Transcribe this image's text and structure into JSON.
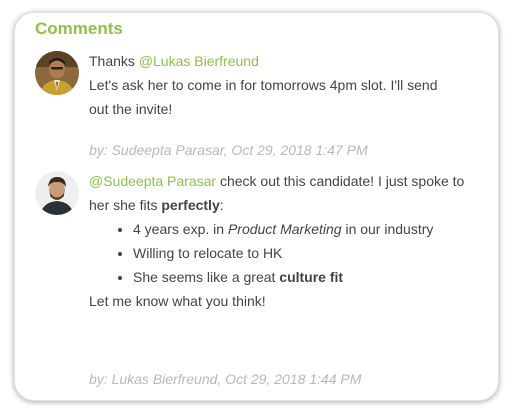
{
  "panel": {
    "title": "Comments"
  },
  "comments": [
    {
      "greeting": "Thanks",
      "mention": "@Lukas Bierfreund",
      "text": "Let's ask her to come in for tomorrows 4pm slot. I'll send out the invite!",
      "byline": "by: Sudeepta Parasar, Oct 29, 2018 1:47 PM"
    },
    {
      "mention": "@Sudeepta Parasar",
      "intro_text": "check out this candidate! I just spoke to her she fits",
      "intro_bold": "perfectly",
      "intro_end": ":",
      "bullets": [
        {
          "prefix": "4 years exp. in",
          "emphasis": "Product Marketing",
          "suffix": "in our industry"
        },
        {
          "text": "Willing to relocate to HK"
        },
        {
          "prefix": "She seems like a great",
          "bold": "culture fit"
        }
      ],
      "closing": "Let me know what you think!",
      "byline": "by: Lukas Bierfreund, Oct 29, 2018 1:44 PM"
    }
  ],
  "colors": {
    "accent": "#8bc34a",
    "text": "#444444",
    "muted": "#b8b8b8"
  },
  "icons": [
    "avatar-sudeepta",
    "avatar-lukas"
  ]
}
